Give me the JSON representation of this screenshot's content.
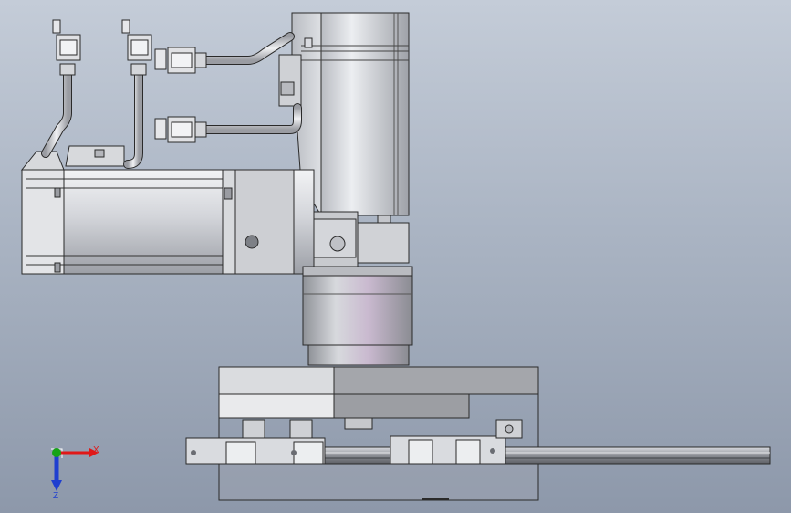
{
  "triad": {
    "x_label": "X",
    "z_label": "Z",
    "x_color": "#e01818",
    "y_color": "#17a317",
    "z_color": "#1f3fd0"
  },
  "palette": {
    "metal_light": "#e8e9ec",
    "metal_mid": "#c3c5ca",
    "metal_dark": "#8e9096",
    "edge": "#2a2a2a"
  }
}
